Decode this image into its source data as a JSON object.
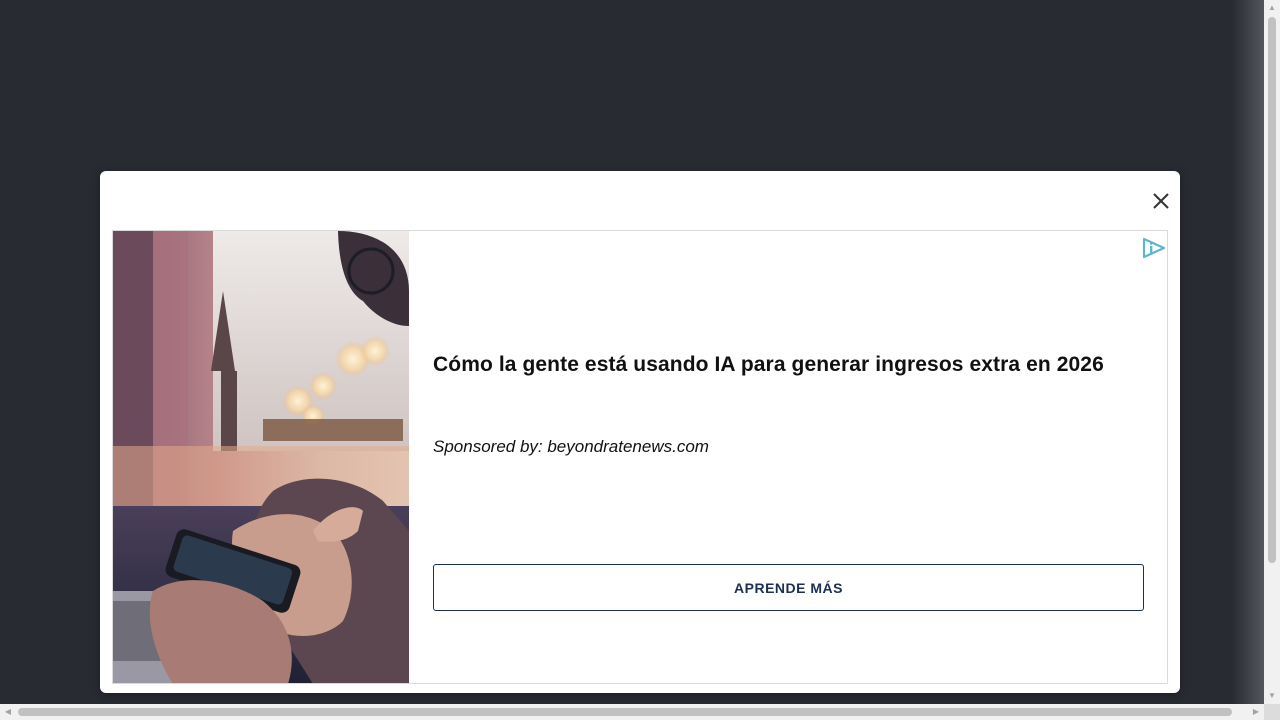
{
  "ad": {
    "headline": "Cómo la gente está usando IA para generar ingresos extra en 2026",
    "sponsor": "Sponsored by: beyondratenews.com",
    "cta_label": "APRENDE MÁS",
    "image_icon": "person-using-smartphone-photo",
    "adchoices_icon": "adchoices-icon"
  },
  "modal": {
    "close_icon": "close-icon"
  },
  "colors": {
    "page_background": "#282b32",
    "modal_background": "#ffffff",
    "cta_border": "#1d2f52",
    "adchoices_accent": "#5fb6c9"
  }
}
